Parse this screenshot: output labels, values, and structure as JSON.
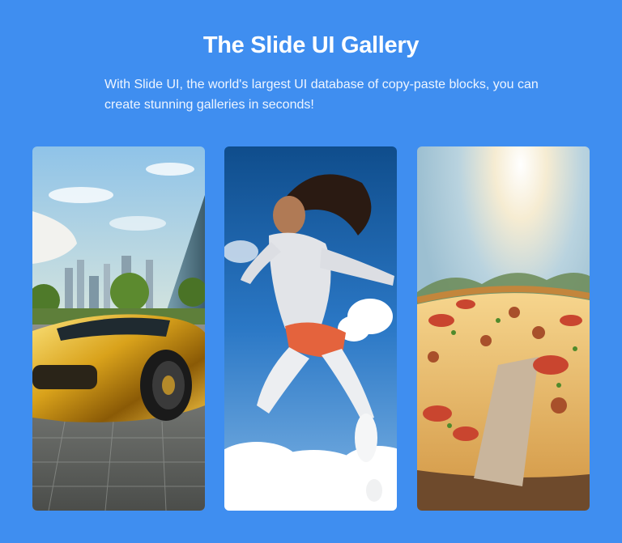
{
  "header": {
    "title": "The Slide UI Gallery",
    "description": "With Slide UI, the world's largest UI database of copy-paste blocks, you can create stunning galleries in seconds!"
  },
  "gallery": {
    "images": [
      {
        "subject": "gold sports car in front of city skyscrapers"
      },
      {
        "subject": "woman jumping against blue sky with clouds"
      },
      {
        "subject": "pizza with tomato and cheese in sunlight"
      }
    ]
  },
  "colors": {
    "background": "#3f8ef0",
    "text": "#ffffff"
  }
}
